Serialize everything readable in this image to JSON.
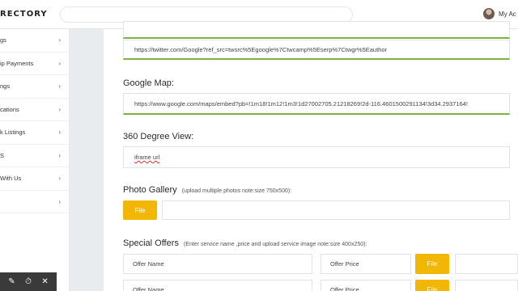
{
  "header": {
    "brand": "RECTORY",
    "account_label": "My Ac",
    "icons": [
      "avatar"
    ]
  },
  "sidebar": {
    "items": [
      {
        "label": "gs"
      },
      {
        "label": "ip Payments"
      },
      {
        "label": "ngs"
      },
      {
        "label": "cations"
      },
      {
        "label": "k Listings"
      },
      {
        "label": "S"
      },
      {
        "label": "With Us"
      },
      {
        "label": ""
      }
    ],
    "chevron": "›"
  },
  "form": {
    "top_partial_value": "",
    "twitter_value": "https://twitter.com/Google?ref_src=twsrc%5Egoogle%7Ctwcamp%5Eserp%7Ctwgr%5Eauthor",
    "google_map": {
      "label": "Google Map:",
      "value": "https://www.google.com/maps/embed?pb=!1m18!1m12!1m3!1d27002705.21218269!2d-116.4601500291134!3d34.2937164!"
    },
    "view360": {
      "label": "360 Degree View:",
      "value": "iframe url"
    },
    "photo_gallery": {
      "label": "Photo Gallery",
      "note": "(upload multiple photos note:size 750x500):",
      "file_button": "File"
    },
    "special_offers": {
      "label": "Special Offers",
      "note": "(Enter service name ,price and upload service image note:size 400x250):",
      "rows": [
        {
          "name_placeholder": "Offer Name",
          "price_placeholder": "Offer Price",
          "file_button": "File"
        },
        {
          "name_placeholder": "Offer Name",
          "price_placeholder": "Offer Price",
          "file_button": "File"
        }
      ]
    }
  },
  "bottom_toolbar": {
    "icons": [
      "pen-icon",
      "timer-icon",
      "close-icon"
    ],
    "glyphs": [
      "✎",
      "⏱",
      "✕"
    ]
  },
  "colors": {
    "accent": "#f2b705",
    "underline_green": "#7cb342",
    "background": "#e9ecee"
  }
}
